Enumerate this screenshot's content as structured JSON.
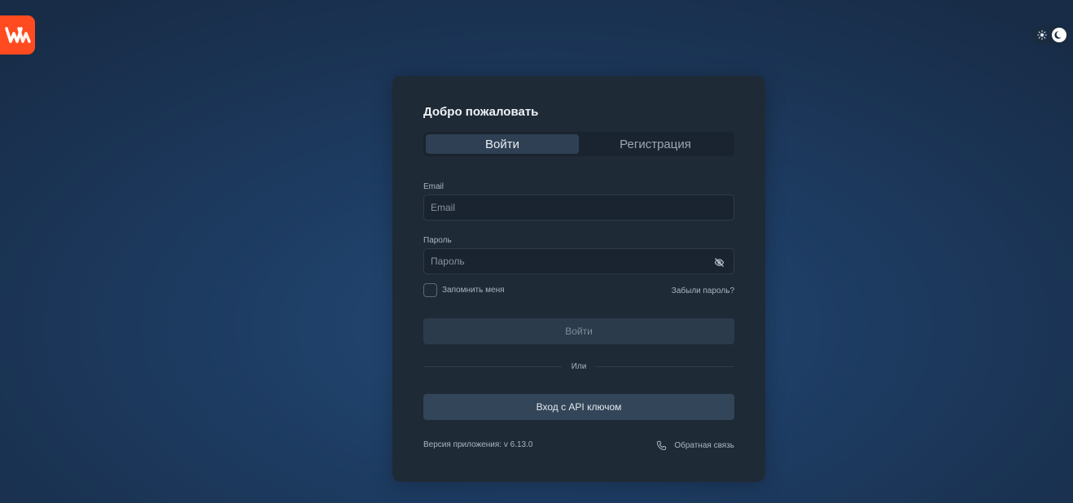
{
  "theme": {
    "background": "#1d3b61",
    "card": "#1f2a37",
    "accent": "#ff4b1f"
  },
  "icons": {
    "logo": "w-logo-icon",
    "light": "sun-icon",
    "dark": "moon-icon",
    "password_toggle": "eye-off-icon",
    "feedback": "phone-icon"
  },
  "card": {
    "title": "Добро пожаловать",
    "tabs": [
      {
        "label": "Войти",
        "active": true
      },
      {
        "label": "Регистрация",
        "active": false
      }
    ]
  },
  "form": {
    "email_label": "Email",
    "email_placeholder": "Email",
    "email_value": "",
    "password_label": "Пароль",
    "password_placeholder": "Пароль",
    "password_value": "",
    "remember_label": "Запомнить меня",
    "forgot_label": "Забыли пароль?",
    "submit_label": "Войти",
    "divider_label": "Или",
    "api_label": "Вход с API ключом"
  },
  "footer": {
    "version": "Версия приложения: v 6.13.0",
    "feedback": "Обратная связь"
  }
}
